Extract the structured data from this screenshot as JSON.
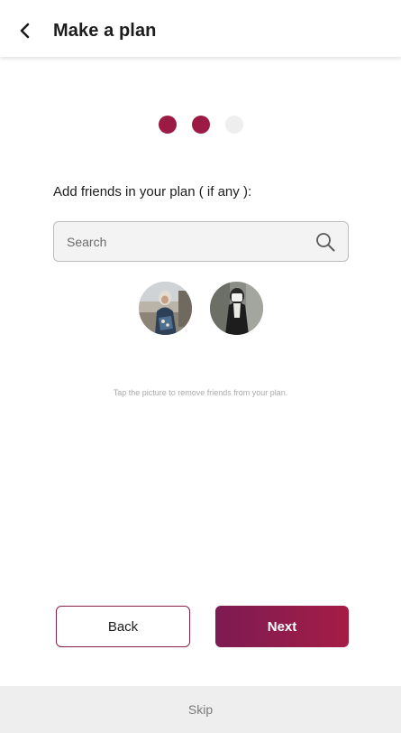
{
  "header": {
    "title": "Make a plan",
    "back_icon": "arrow-left-icon"
  },
  "steps": {
    "total": 3,
    "completed": 2,
    "active_color": "#9b1b45",
    "inactive_color": "#eeeeee"
  },
  "main": {
    "prompt": "Add friends in your plan ( if any ):",
    "search": {
      "placeholder": "Search",
      "value": "",
      "icon": "search-icon"
    },
    "friends": [
      {
        "name": "friend-avatar-1",
        "alt": "Friend photo"
      },
      {
        "name": "friend-avatar-2",
        "alt": "Friend photo"
      }
    ],
    "hint": "Tap the picture to remove friends from your plan."
  },
  "buttons": {
    "back_label": "Back",
    "next_label": "Next"
  },
  "skip": {
    "label": "Skip"
  },
  "colors": {
    "brand": "#9b1b45",
    "brand_dark": "#7c1b52",
    "skip_bg": "#eeeeee"
  }
}
